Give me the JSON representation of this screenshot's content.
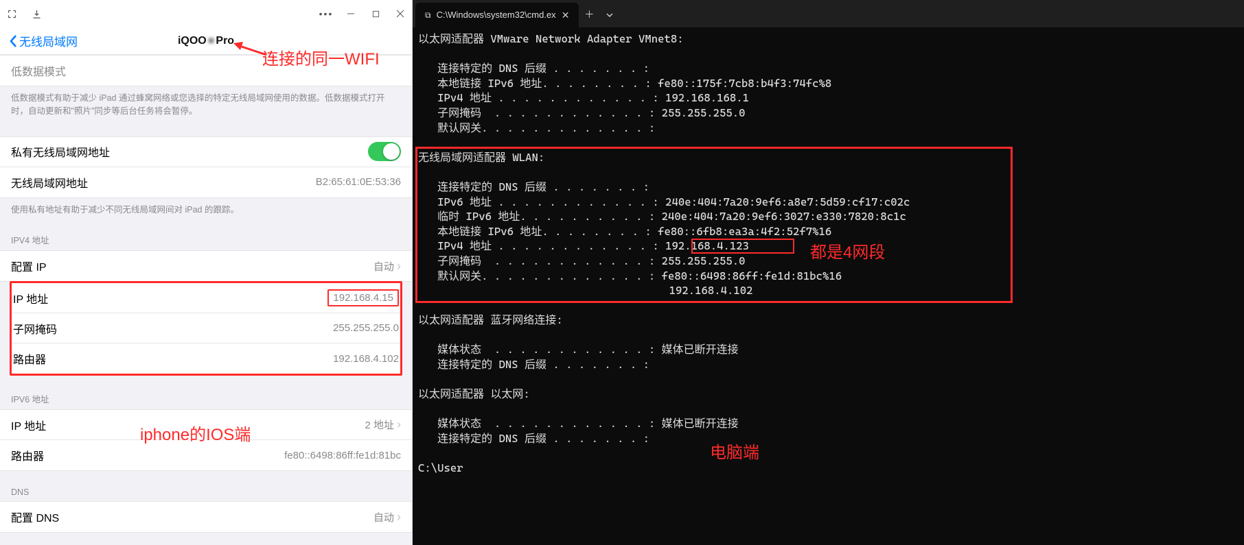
{
  "left": {
    "back_label": "无线局域网",
    "title_prefix": "iQOO",
    "title_suffix": "Pro",
    "blurred_mid": "■",
    "low_data_row": "低数据模式",
    "low_data_desc": "低数据模式有助于减少 iPad 通过蜂窝网络或您选择的特定无线局域网使用的数据。低数据模式打开时，自动更新和\"照片\"同步等后台任务将会暂停。",
    "private_addr_label": "私有无线局域网地址",
    "wlan_addr_label": "无线局域网地址",
    "wlan_addr_value": "B2:65:61:0E:53:36",
    "private_desc": "使用私有地址有助于减少不同无线局域网间对 iPad 的跟踪。",
    "ipv4_section": "IPV4 地址",
    "config_ip_label": "配置 IP",
    "config_ip_value": "自动",
    "ip_addr_label": "IP 地址",
    "ip_addr_value": "192.168.4.15",
    "subnet_label": "子网掩码",
    "subnet_value": "255.255.255.0",
    "router_label": "路由器",
    "router_value": "192.168.4.102",
    "ipv6_section": "IPV6 地址",
    "ipv6_ip_label": "IP 地址",
    "ipv6_ip_value": "2 地址",
    "ipv6_router_label": "路由器",
    "ipv6_router_value": "fe80::6498:86ff:fe1d:81bc",
    "dns_section": "DNS",
    "config_dns_label": "配置 DNS",
    "config_dns_value": "自动"
  },
  "right": {
    "tab_title": "C:\\Windows\\system32\\cmd.ex",
    "body": [
      "以太网适配器 VMware Network Adapter VMnet8:",
      "",
      "   连接特定的 DNS 后缀 . . . . . . . :",
      "   本地链接 IPv6 地址. . . . . . . . : fe80::175f:7cb8:b4f3:74fc%8",
      "   IPv4 地址 . . . . . . . . . . . . : 192.168.168.1",
      "   子网掩码  . . . . . . . . . . . . : 255.255.255.0",
      "   默认网关. . . . . . . . . . . . . :",
      "",
      "无线局域网适配器 WLAN:",
      "",
      "   连接特定的 DNS 后缀 . . . . . . . :",
      "   IPv6 地址 . . . . . . . . . . . . : 240e:404:7a20:9ef6:a8e7:5d59:cf17:c02c",
      "   临时 IPv6 地址. . . . . . . . . . : 240e:404:7a20:9ef6:3027:e330:7820:8c1c",
      "   本地链接 IPv6 地址. . . . . . . . : fe80::6fb8:ea3a:4f2:52f7%16",
      "   IPv4 地址 . . . . . . . . . . . . : 192.168.4.123",
      "   子网掩码  . . . . . . . . . . . . : 255.255.255.0",
      "   默认网关. . . . . . . . . . . . . : fe80::6498:86ff:fe1d:81bc%16",
      "                                       192.168.4.102",
      "",
      "以太网适配器 蓝牙网络连接:",
      "",
      "   媒体状态  . . . . . . . . . . . . : 媒体已断开连接",
      "   连接特定的 DNS 后缀 . . . . . . . :",
      "",
      "以太网适配器 以太网:",
      "",
      "   媒体状态  . . . . . . . . . . . . : 媒体已断开连接",
      "   连接特定的 DNS 后缀 . . . . . . . :",
      "",
      "C:\\User"
    ]
  },
  "annotations": {
    "same_wifi": "连接的同一WIFI",
    "ios_side": "iphone的IOS端",
    "same_segment": "都是4网段",
    "pc_side": "电脑端"
  }
}
